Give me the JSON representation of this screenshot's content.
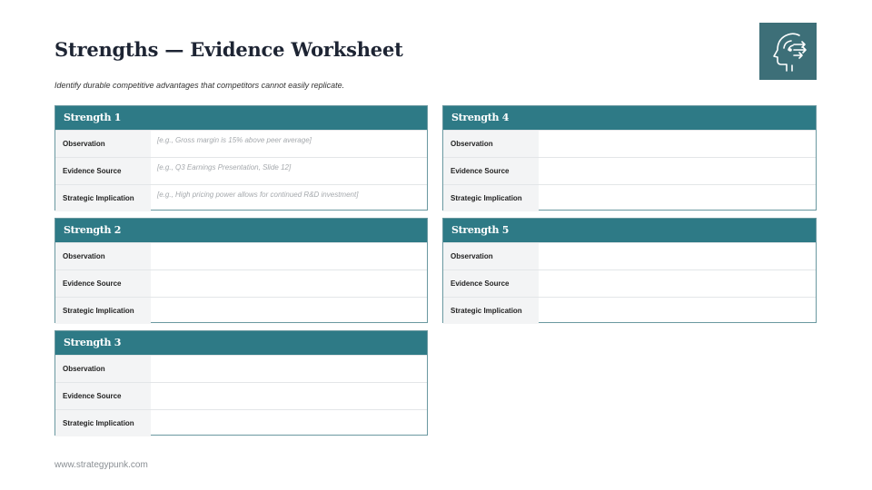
{
  "header": {
    "title": "Strengths — Evidence Worksheet",
    "subtitle": "Identify durable competitive advantages that competitors cannot easily replicate."
  },
  "logo": {
    "icon": "head-arrows-icon",
    "bg_color": "#3d6f78"
  },
  "theme": {
    "accent": "#2e7a86",
    "border": "#6a98a0",
    "label_bg": "#f3f4f5"
  },
  "cards": [
    {
      "title": "Strength 1",
      "rows": [
        {
          "label": "Observation",
          "value": "[e.g., Gross margin is 15% above peer average]"
        },
        {
          "label": "Evidence Source",
          "value": "[e.g., Q3 Earnings Presentation, Slide 12]"
        },
        {
          "label": "Strategic Implication",
          "value": "[e.g., High pricing power allows for continued R&D investment]"
        }
      ]
    },
    {
      "title": "Strength 2",
      "rows": [
        {
          "label": "Observation",
          "value": ""
        },
        {
          "label": "Evidence Source",
          "value": ""
        },
        {
          "label": "Strategic Implication",
          "value": ""
        }
      ]
    },
    {
      "title": "Strength 3",
      "rows": [
        {
          "label": "Observation",
          "value": ""
        },
        {
          "label": "Evidence Source",
          "value": ""
        },
        {
          "label": "Strategic Implication",
          "value": ""
        }
      ]
    },
    {
      "title": "Strength 4",
      "rows": [
        {
          "label": "Observation",
          "value": ""
        },
        {
          "label": "Evidence Source",
          "value": ""
        },
        {
          "label": "Strategic Implication",
          "value": ""
        }
      ]
    },
    {
      "title": "Strength 5",
      "rows": [
        {
          "label": "Observation",
          "value": ""
        },
        {
          "label": "Evidence Source",
          "value": ""
        },
        {
          "label": "Strategic Implication",
          "value": ""
        }
      ]
    }
  ],
  "footer": {
    "text": "www.strategypunk.com"
  }
}
